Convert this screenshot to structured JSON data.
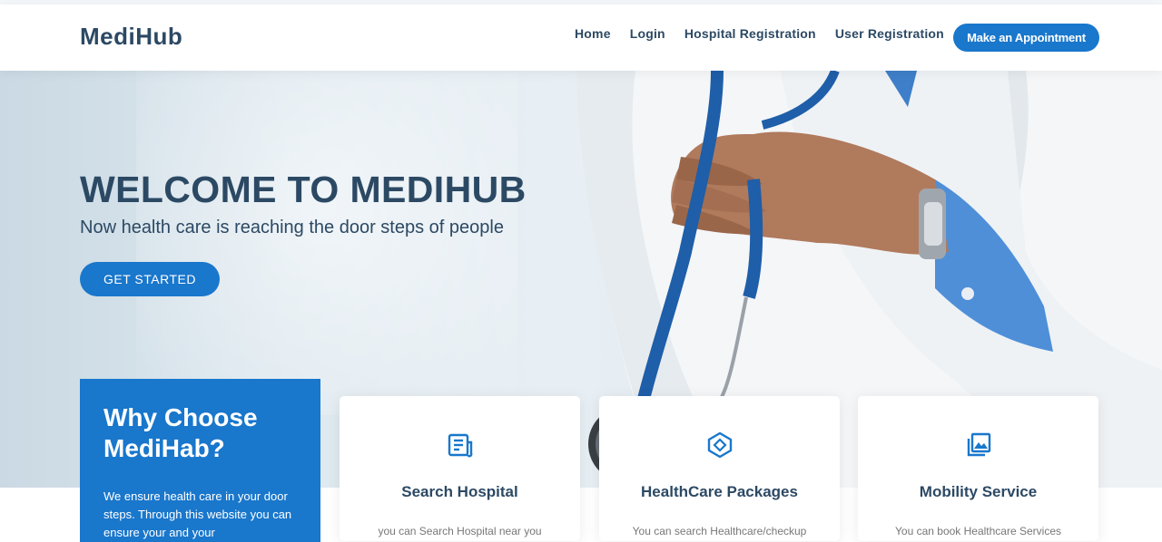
{
  "brand": {
    "name": "MediHub"
  },
  "nav": {
    "items": [
      {
        "label": "Home"
      },
      {
        "label": "Login"
      },
      {
        "label": "Hospital Registration"
      },
      {
        "label": "User Registration"
      }
    ],
    "cta_label": "Make an Appointment"
  },
  "hero": {
    "title": "WELCOME TO MEDIHUB",
    "subtitle": "Now health care is reaching the door steps of people",
    "button_label": "GET STARTED"
  },
  "why": {
    "title": "Why Choose MediHab?",
    "text": "We ensure health care in your door steps. Through this website you can ensure your and your"
  },
  "cards": [
    {
      "title": "Search Hospital",
      "text": "you can Search Hospital near you",
      "icon": "document-list-icon"
    },
    {
      "title": "HealthCare Packages",
      "text": "You can search Healthcare/checkup",
      "icon": "hexagon-cube-icon"
    },
    {
      "title": "Mobility Service",
      "text": "You can book Healthcare Services",
      "icon": "image-stack-icon"
    }
  ],
  "colors": {
    "primary": "#1977cc",
    "heading": "#2c4964",
    "white": "#ffffff"
  }
}
